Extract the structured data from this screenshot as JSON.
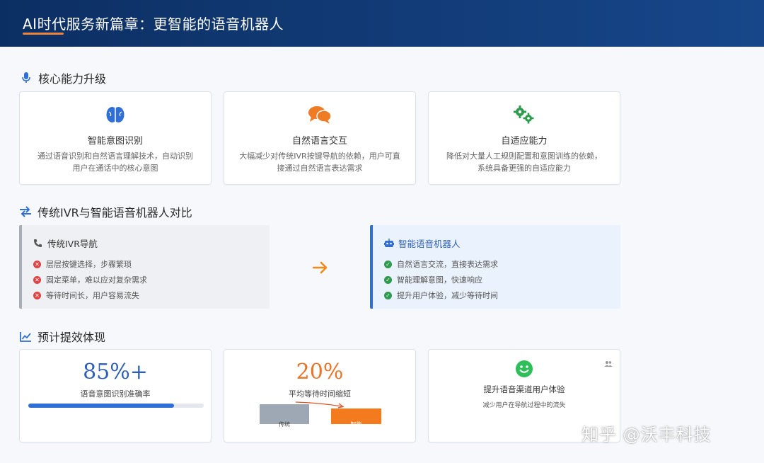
{
  "header": {
    "title": "AI时代服务新篇章：更智能的语音机器人"
  },
  "sections": {
    "capabilities": {
      "title": "核心能力升级",
      "icon": "microphone-icon"
    },
    "comparison": {
      "title": "传统IVR与智能语音机器人对比",
      "icon": "exchange-arrows-icon"
    },
    "metrics": {
      "title": "预计提效体现",
      "icon": "line-chart-icon"
    }
  },
  "capabilities": [
    {
      "icon": "brain-icon",
      "color": "#2f6fd6",
      "title": "智能意图识别",
      "desc_line1": "通过语音识别和自然语言理解技术，自动识别",
      "desc_line2": "用户在通话中的核心意图"
    },
    {
      "icon": "chat-bubbles-icon",
      "color": "#f07b25",
      "title": "自然语言交互",
      "desc_line1": "大幅减少对传统IVR按键导航的依赖，用户可直",
      "desc_line2": "接通过自然语言表达需求"
    },
    {
      "icon": "gears-icon",
      "color": "#2e9b4e",
      "title": "自适应能力",
      "desc_line1": "降低对大量人工规则配置和意图训练的依赖，",
      "desc_line2": "系统具备更强的自适应能力"
    }
  ],
  "comparison": {
    "traditional": {
      "title": "传统IVR导航",
      "icon": "phone-icon",
      "items": [
        "层层按键选择，步骤繁琐",
        "固定菜单，难以应对复杂需求",
        "等待时间长，用户容易流失"
      ]
    },
    "arrow_icon": "arrow-right-icon",
    "smart": {
      "title": "智能语音机器人",
      "icon": "robot-icon",
      "items": [
        "自然语言交流，直接表达需求",
        "智能理解意图，快速响应",
        "提升用户体验，减少等待时间"
      ]
    }
  },
  "metrics": [
    {
      "value": "85%+",
      "label": "语音意图识别准确率",
      "progress_percent": 83,
      "color": "#2f6fd6"
    },
    {
      "value": "20%",
      "label": "平均等待时间缩短",
      "bar_traditional": "传统",
      "bar_smart": "智能",
      "color": "#f07b25"
    },
    {
      "icon": "smile-icon",
      "title": "提升语音渠道用户体验",
      "desc": "减少用户在导航过程中的流失",
      "corner_icon": "users-icon"
    }
  ],
  "watermark": "知乎 @沃丰科技",
  "colors": {
    "header_bg": "#0f3670",
    "accent_orange": "#f0843a",
    "blue": "#2f6fd6",
    "green": "#2e9b4e",
    "red": "#e04343",
    "grey_border": "#a9aeb6"
  }
}
